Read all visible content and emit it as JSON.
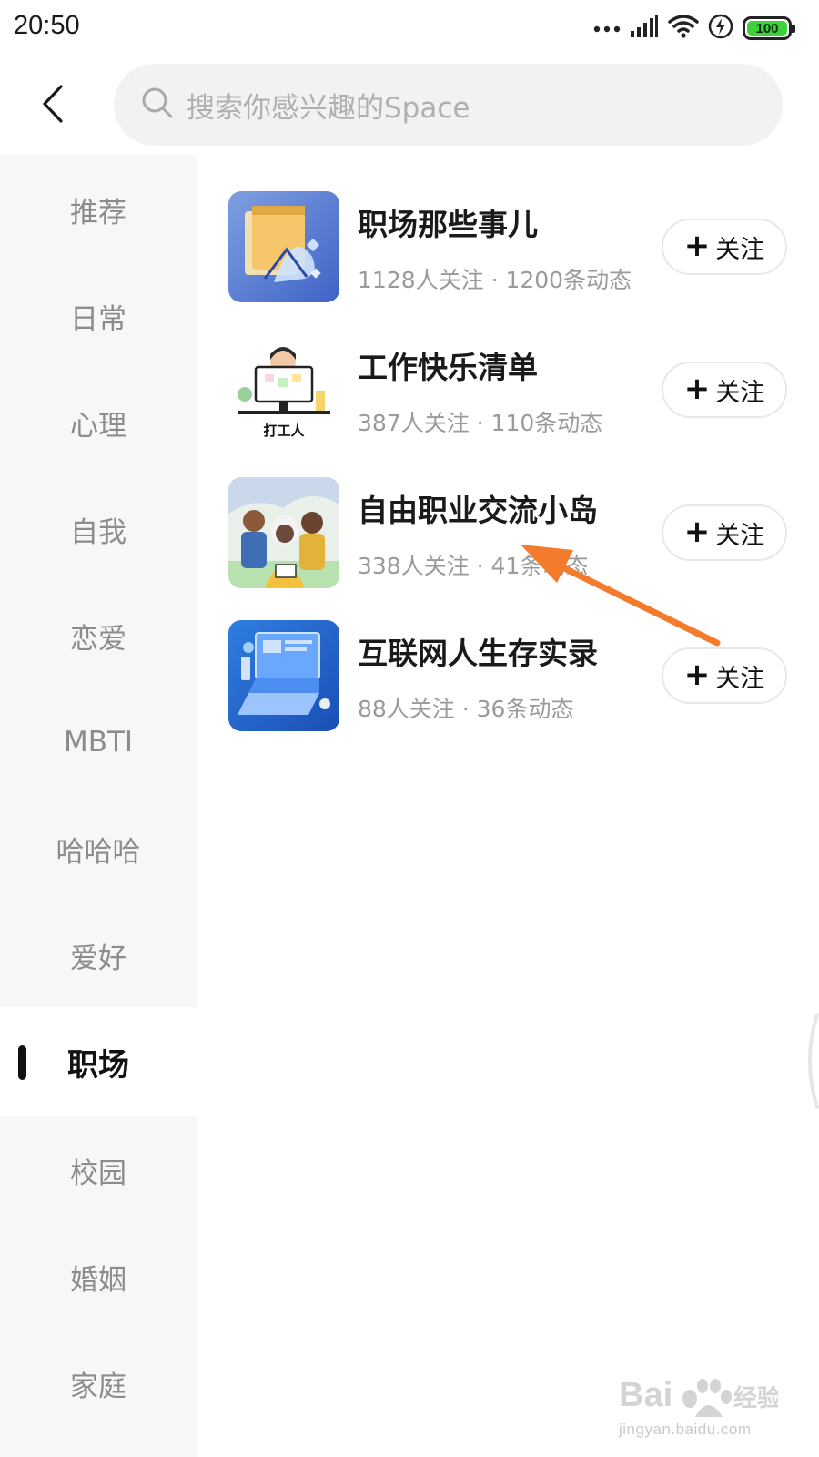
{
  "status_bar": {
    "time": "20:50",
    "battery": "100",
    "battery_level": 1.0
  },
  "search": {
    "placeholder": "搜索你感兴趣的Space"
  },
  "sidebar": {
    "items": [
      {
        "label": "推荐"
      },
      {
        "label": "日常"
      },
      {
        "label": "心理"
      },
      {
        "label": "自我"
      },
      {
        "label": "恋爱"
      },
      {
        "label": "MBTI"
      },
      {
        "label": "哈哈哈"
      },
      {
        "label": "爱好"
      },
      {
        "label": "职场",
        "active": true
      },
      {
        "label": "校园"
      },
      {
        "label": "婚姻"
      },
      {
        "label": "家庭"
      }
    ]
  },
  "spaces": [
    {
      "title": "职场那些事儿",
      "meta": "1128人关注 · 1200条动态",
      "follow_label": "关注"
    },
    {
      "title": "工作快乐清单",
      "meta": "387人关注 · 110条动态",
      "follow_label": "关注"
    },
    {
      "title": "自由职业交流小岛",
      "meta": "338人关注 · 41条动态",
      "follow_label": "关注"
    },
    {
      "title": "互联网人生存实录",
      "meta": "88人关注 · 36条动态",
      "follow_label": "关注"
    }
  ],
  "thumb_texts": {
    "work_list_caption": "打工人"
  },
  "watermark": {
    "brand": "Baidu经验",
    "domain": "jingyan.baidu.com"
  },
  "colors": {
    "accent_arrow": "#f47a2c",
    "battery_green": "#3fd13a",
    "sidebar_bg": "#f7f7f7"
  }
}
